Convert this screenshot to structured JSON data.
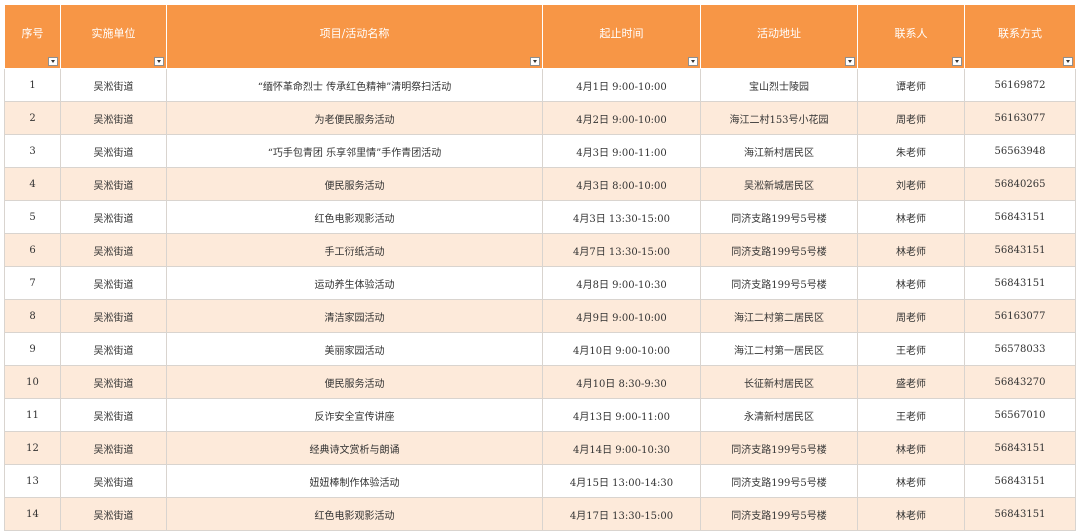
{
  "table": {
    "headers": [
      "序号",
      "实施单位",
      "项目/活动名称",
      "起止时间",
      "活动地址",
      "联系人",
      "联系方式"
    ],
    "rows": [
      [
        "1",
        "吴淞街道",
        "“缅怀革命烈士 传承红色精神”清明祭扫活动",
        "4月1日 9:00-10:00",
        "宝山烈士陵园",
        "谭老师",
        "56169872"
      ],
      [
        "2",
        "吴淞街道",
        "为老便民服务活动",
        "4月2日 9:00-10:00",
        "海江二村153号小花园",
        "周老师",
        "56163077"
      ],
      [
        "3",
        "吴淞街道",
        "“巧手包青团 乐享邻里情”手作青团活动",
        "4月3日 9:00-11:00",
        "海江新村居民区",
        "朱老师",
        "56563948"
      ],
      [
        "4",
        "吴淞街道",
        "便民服务活动",
        "4月3日 8:00-10:00",
        "吴淞新城居民区",
        "刘老师",
        "56840265"
      ],
      [
        "5",
        "吴淞街道",
        "红色电影观影活动",
        "4月3日 13:30-15:00",
        "同济支路199号5号楼",
        "林老师",
        "56843151"
      ],
      [
        "6",
        "吴淞街道",
        "手工衍纸活动",
        "4月7日 13:30-15:00",
        "同济支路199号5号楼",
        "林老师",
        "56843151"
      ],
      [
        "7",
        "吴淞街道",
        "运动养生体验活动",
        "4月8日 9:00-10:30",
        "同济支路199号5号楼",
        "林老师",
        "56843151"
      ],
      [
        "8",
        "吴淞街道",
        "清洁家园活动",
        "4月9日 9:00-10:00",
        "海江二村第二居民区",
        "周老师",
        "56163077"
      ],
      [
        "9",
        "吴淞街道",
        "美丽家园活动",
        "4月10日 9:00-10:00",
        "海江二村第一居民区",
        "王老师",
        "56578033"
      ],
      [
        "10",
        "吴淞街道",
        "便民服务活动",
        "4月10日 8:30-9:30",
        "长征新村居民区",
        "盛老师",
        "56843270"
      ],
      [
        "11",
        "吴淞街道",
        "反诈安全宣传讲座",
        "4月13日 9:00-11:00",
        "永清新村居民区",
        "王老师",
        "56567010"
      ],
      [
        "12",
        "吴淞街道",
        "经典诗文赏析与朗诵",
        "4月14日 9:00-10:30",
        "同济支路199号5号楼",
        "林老师",
        "56843151"
      ],
      [
        "13",
        "吴淞街道",
        "妞妞棒制作体验活动",
        "4月15日 13:00-14:30",
        "同济支路199号5号楼",
        "林老师",
        "56843151"
      ],
      [
        "14",
        "吴淞街道",
        "红色电影观影活动",
        "4月17日 13:30-15:00",
        "同济支路199号5号楼",
        "林老师",
        "56843151"
      ]
    ]
  },
  "colors": {
    "header_bg": "#f79646",
    "band_bg": "#fdeada",
    "header_text": "#ffffff",
    "cell_text": "#333333"
  },
  "icons": {
    "filter": "filter-dropdown-icon"
  }
}
